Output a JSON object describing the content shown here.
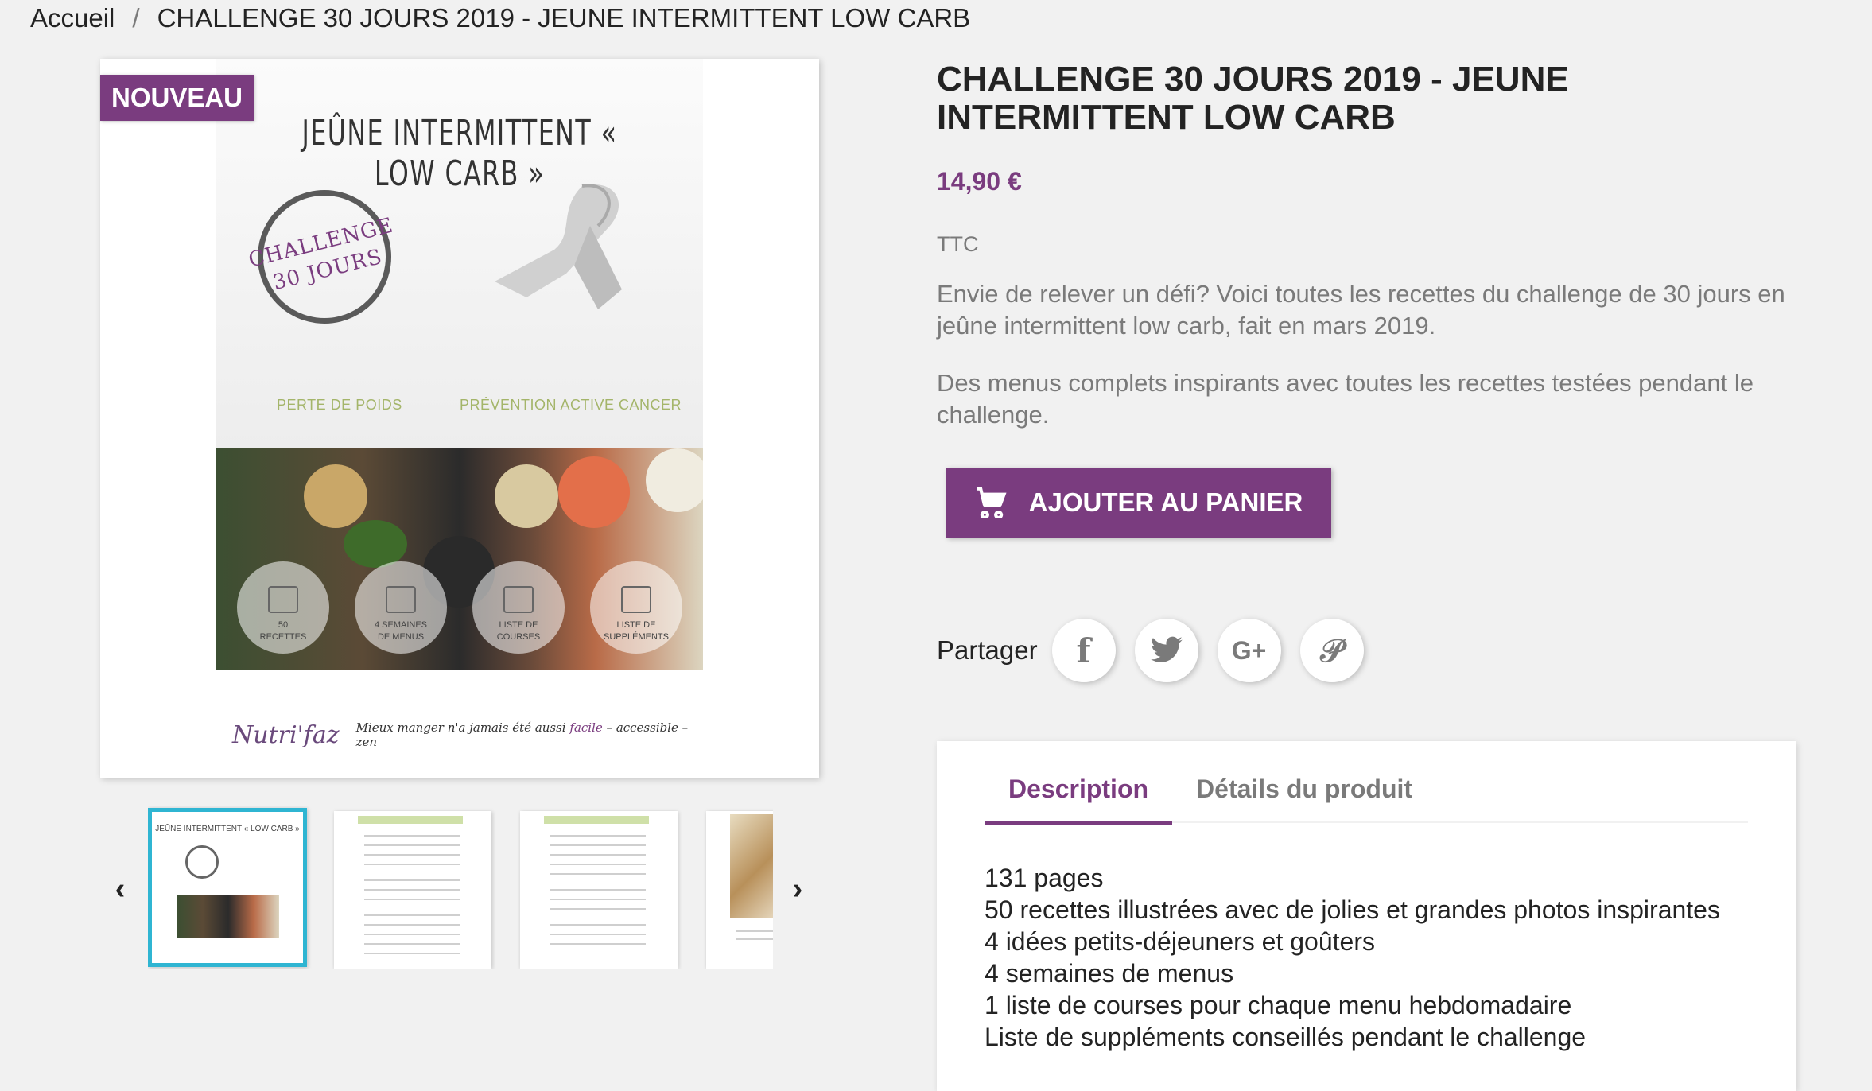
{
  "breadcrumb": {
    "home": "Accueil",
    "separator": "/",
    "current": "CHALLENGE 30 JOURS 2019 - JEUNE INTERMITTENT LOW CARB"
  },
  "badge": "NOUVEAU",
  "cover": {
    "title": "JEÛNE INTERMITTENT « LOW CARB »",
    "stamp_line1": "CHALLENGE",
    "stamp_line2": "30 JOURS",
    "subtitle_left": "PERTE DE POIDS",
    "subtitle_right": "PRÉVENTION ACTIVE CANCER",
    "features": [
      {
        "line1": "50",
        "line2": "RECETTES"
      },
      {
        "line1": "4 SEMAINES",
        "line2": "DE MENUS"
      },
      {
        "line1": "LISTE DE",
        "line2": "COURSES"
      },
      {
        "line1": "LISTE DE",
        "line2": "SUPPLÉMENTS"
      }
    ],
    "logo": "Nutri'faz",
    "tagline_start": "Mieux manger n'a jamais été aussi",
    "tagline_facile": "facile",
    "tagline_rest": "– accessible – zen"
  },
  "thumb_mini_title": "JEÛNE INTERMITTENT « LOW CARB »",
  "product": {
    "title": "CHALLENGE 30 JOURS 2019 - JEUNE INTERMITTENT LOW CARB",
    "price": "14,90 €",
    "tax": "TTC",
    "description_1": "Envie de relever un défi? Voici toutes les recettes du challenge de 30 jours en jeûne intermittent low carb, fait en mars 2019.",
    "description_2": "Des menus complets inspirants avec toutes les recettes testées pendant le challenge.",
    "add_to_cart": "AJOUTER AU PANIER"
  },
  "share": {
    "label": "Partager",
    "icons": [
      "facebook-icon",
      "twitter-icon",
      "google-plus-icon",
      "pinterest-icon"
    ]
  },
  "tabs": {
    "description": "Description",
    "details": "Détails du produit"
  },
  "description_lines": [
    "131 pages",
    "50 recettes illustrées avec de jolies et grandes photos inspirantes",
    "4 idées petits-déjeuners et goûters",
    "4 semaines de menus",
    "1 liste de courses pour chaque menu hebdomadaire",
    "Liste de suppléments conseillés pendant le challenge"
  ],
  "colors": {
    "brand": "#7a3c7f",
    "thumb_active_border": "#2fb5d2",
    "background": "#f1f1f1"
  }
}
